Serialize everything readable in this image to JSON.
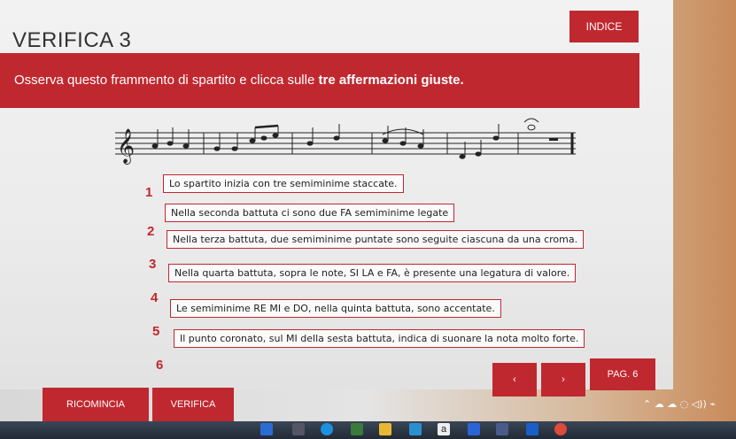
{
  "header": {
    "title": "VERIFICA 3",
    "index_label": "INDICE"
  },
  "banner": {
    "instruction_plain": "Osserva questo frammento di spartito e clicca sulle ",
    "instruction_bold": "tre affermazioni giuste."
  },
  "questions": [
    {
      "num": "1",
      "text": "Lo spartito inizia con tre semiminime staccate."
    },
    {
      "num": "2",
      "text": "Nella seconda battuta ci sono due FA semiminime legate"
    },
    {
      "num": "3",
      "text": "Nella terza battuta, due semiminime puntate sono seguite ciascuna da una croma."
    },
    {
      "num": "4",
      "text": "Nella quarta battuta, sopra le note, SI LA e FA, è presente una legatura di valore."
    },
    {
      "num": "5",
      "text": "Le semiminime RE MI e DO, nella quinta battuta, sono accentate."
    },
    {
      "num": "6",
      "text": "Il punto coronato, sul MI della sesta battuta, indica di suonare la nota molto forte."
    }
  ],
  "nav": {
    "prev": "‹",
    "next": "›",
    "page": "PAG. 6"
  },
  "footer": {
    "restart": "RICOMINCIA",
    "check": "VERIFICA"
  },
  "taskbar": {
    "letter_icon": "a",
    "tray_icons": "⌃  ☁  ☁  ◌  ◁))  ⌁"
  },
  "colors": {
    "accent": "#c0282f"
  }
}
